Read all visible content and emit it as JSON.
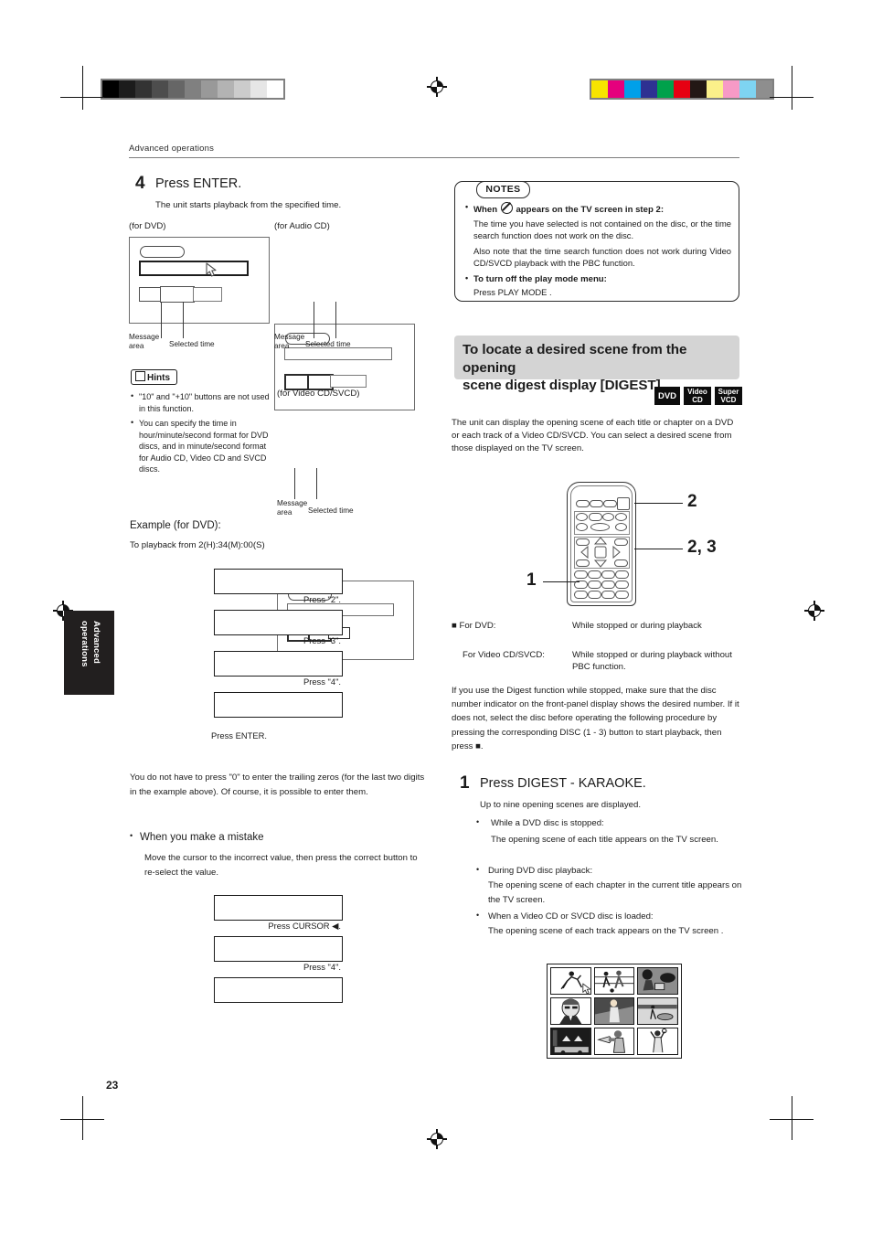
{
  "page": {
    "running_head": "Advanced operations",
    "page_number": "23",
    "side_tab": "Advanced operations"
  },
  "calibration": {
    "gray_swatches": [
      "#000000",
      "#1c1c1c",
      "#333333",
      "#4d4d4d",
      "#666666",
      "#808080",
      "#999999",
      "#b3b3b3",
      "#cccccc",
      "#e6e6e6",
      "#ffffff"
    ],
    "color_swatches": [
      "#f7e400",
      "#e5007d",
      "#00a0e9",
      "#2e3192",
      "#00a14b",
      "#e60012",
      "#231815",
      "#fbf08a",
      "#f79ac6",
      "#7ed4f2",
      "#8e8e8e"
    ]
  },
  "left_column": {
    "step4": {
      "number": "4",
      "heading": "Press ENTER.",
      "body": "The unit starts playback from the specified time."
    },
    "screens": [
      {
        "label": "(for DVD)",
        "caption_message": "Message\narea",
        "caption_time": "Selected time"
      },
      {
        "label": "(for Audio CD)",
        "caption_message": "Message\narea",
        "caption_time": "Selected time"
      },
      {
        "label": "(for Video CD/SVCD)",
        "caption_message": "Message\narea",
        "caption_time": "Selected time"
      }
    ],
    "hints": {
      "title": "Hints",
      "items": [
        "\"10\" and \"+10\" buttons are not used in this function.",
        "You can specify the time in hour/minute/second format for DVD discs, and in minute/second format for Audio CD, Video CD and SVCD discs."
      ]
    },
    "example": {
      "title": "Example (for DVD):",
      "subtitle": "To playback from 2(H):34(M):00(S)",
      "steps": [
        "Press \"2\".",
        "Press \"3\".",
        "Press \"4\".",
        "Press ENTER."
      ]
    },
    "note_trailing": "You do not have to press \"0\" to enter the trailing zeros (for the last two digits in the example above). Of course, it is possible to enter them.",
    "mistake": {
      "heading": "When you make a mistake",
      "body": "Move the cursor to the incorrect value, then press the correct button to re-select the value.",
      "steps": [
        "Press CURSOR ◀.",
        "Press \"4\"."
      ]
    }
  },
  "right_column": {
    "notes": {
      "tag": "NOTES",
      "bullet1_bold_pre": "When",
      "bullet1_bold_post": "appears on the TV screen in step 2:",
      "bullet1_p1": "The time you have selected is not contained on the disc, or the time search function does not work on the disc.",
      "bullet1_p2": "Also note that the time search function does not work during Video CD/SVCD playback with the PBC function.",
      "bullet2_bold": "To turn off the play mode menu:",
      "bullet2_p1": "Press PLAY MODE ."
    },
    "section": {
      "heading_line1": "To locate a desired scene from the opening",
      "heading_line2": "scene digest display [DIGEST]",
      "badges": [
        {
          "line1": "DVD",
          "line2": ""
        },
        {
          "line1": "Video",
          "line2": "CD"
        },
        {
          "line1": "Super",
          "line2": "VCD"
        }
      ],
      "intro": "The unit can display the opening scene of each title or chapter on a DVD or each track of a Video CD/SVCD. You can select a desired scene from those displayed on the TV screen."
    },
    "remote_callouts": [
      "2",
      "2, 3",
      "1"
    ],
    "availability": [
      {
        "label": "■ For DVD:",
        "value": "While stopped or during playback"
      },
      {
        "label": "For Video CD/SVCD:",
        "value": "While stopped or during playback  without PBC function."
      }
    ],
    "digest_note": "If you use the Digest function while stopped, make sure that the disc number indicator on the front-panel display shows the desired number. If it does not, select the disc before operating the following procedure by pressing the corresponding DISC (1 - 3) button to start playback, then press ■.",
    "step1": {
      "number": "1",
      "heading": "Press DIGEST - KARAOKE.",
      "body": "Up to nine opening scenes are displayed.",
      "bullets": [
        {
          "head": "While a DVD disc is stopped:",
          "body": "The opening scene of each title appears on the TV screen."
        },
        {
          "head": "During DVD disc playback:",
          "body": "The opening scene of each chapter in the current title appears on the TV screen."
        },
        {
          "head": "When a Video CD or SVCD disc is loaded:",
          "body": "The opening scene of each track appears on the TV screen ."
        }
      ]
    },
    "digest_grid": {
      "scenes": [
        "baseball-batter",
        "soccer-players",
        "table-tennis",
        "man-portrait",
        "street-scene",
        "beach-scene",
        "stage-lights",
        "trumpet-player",
        "basketball-player"
      ]
    }
  }
}
